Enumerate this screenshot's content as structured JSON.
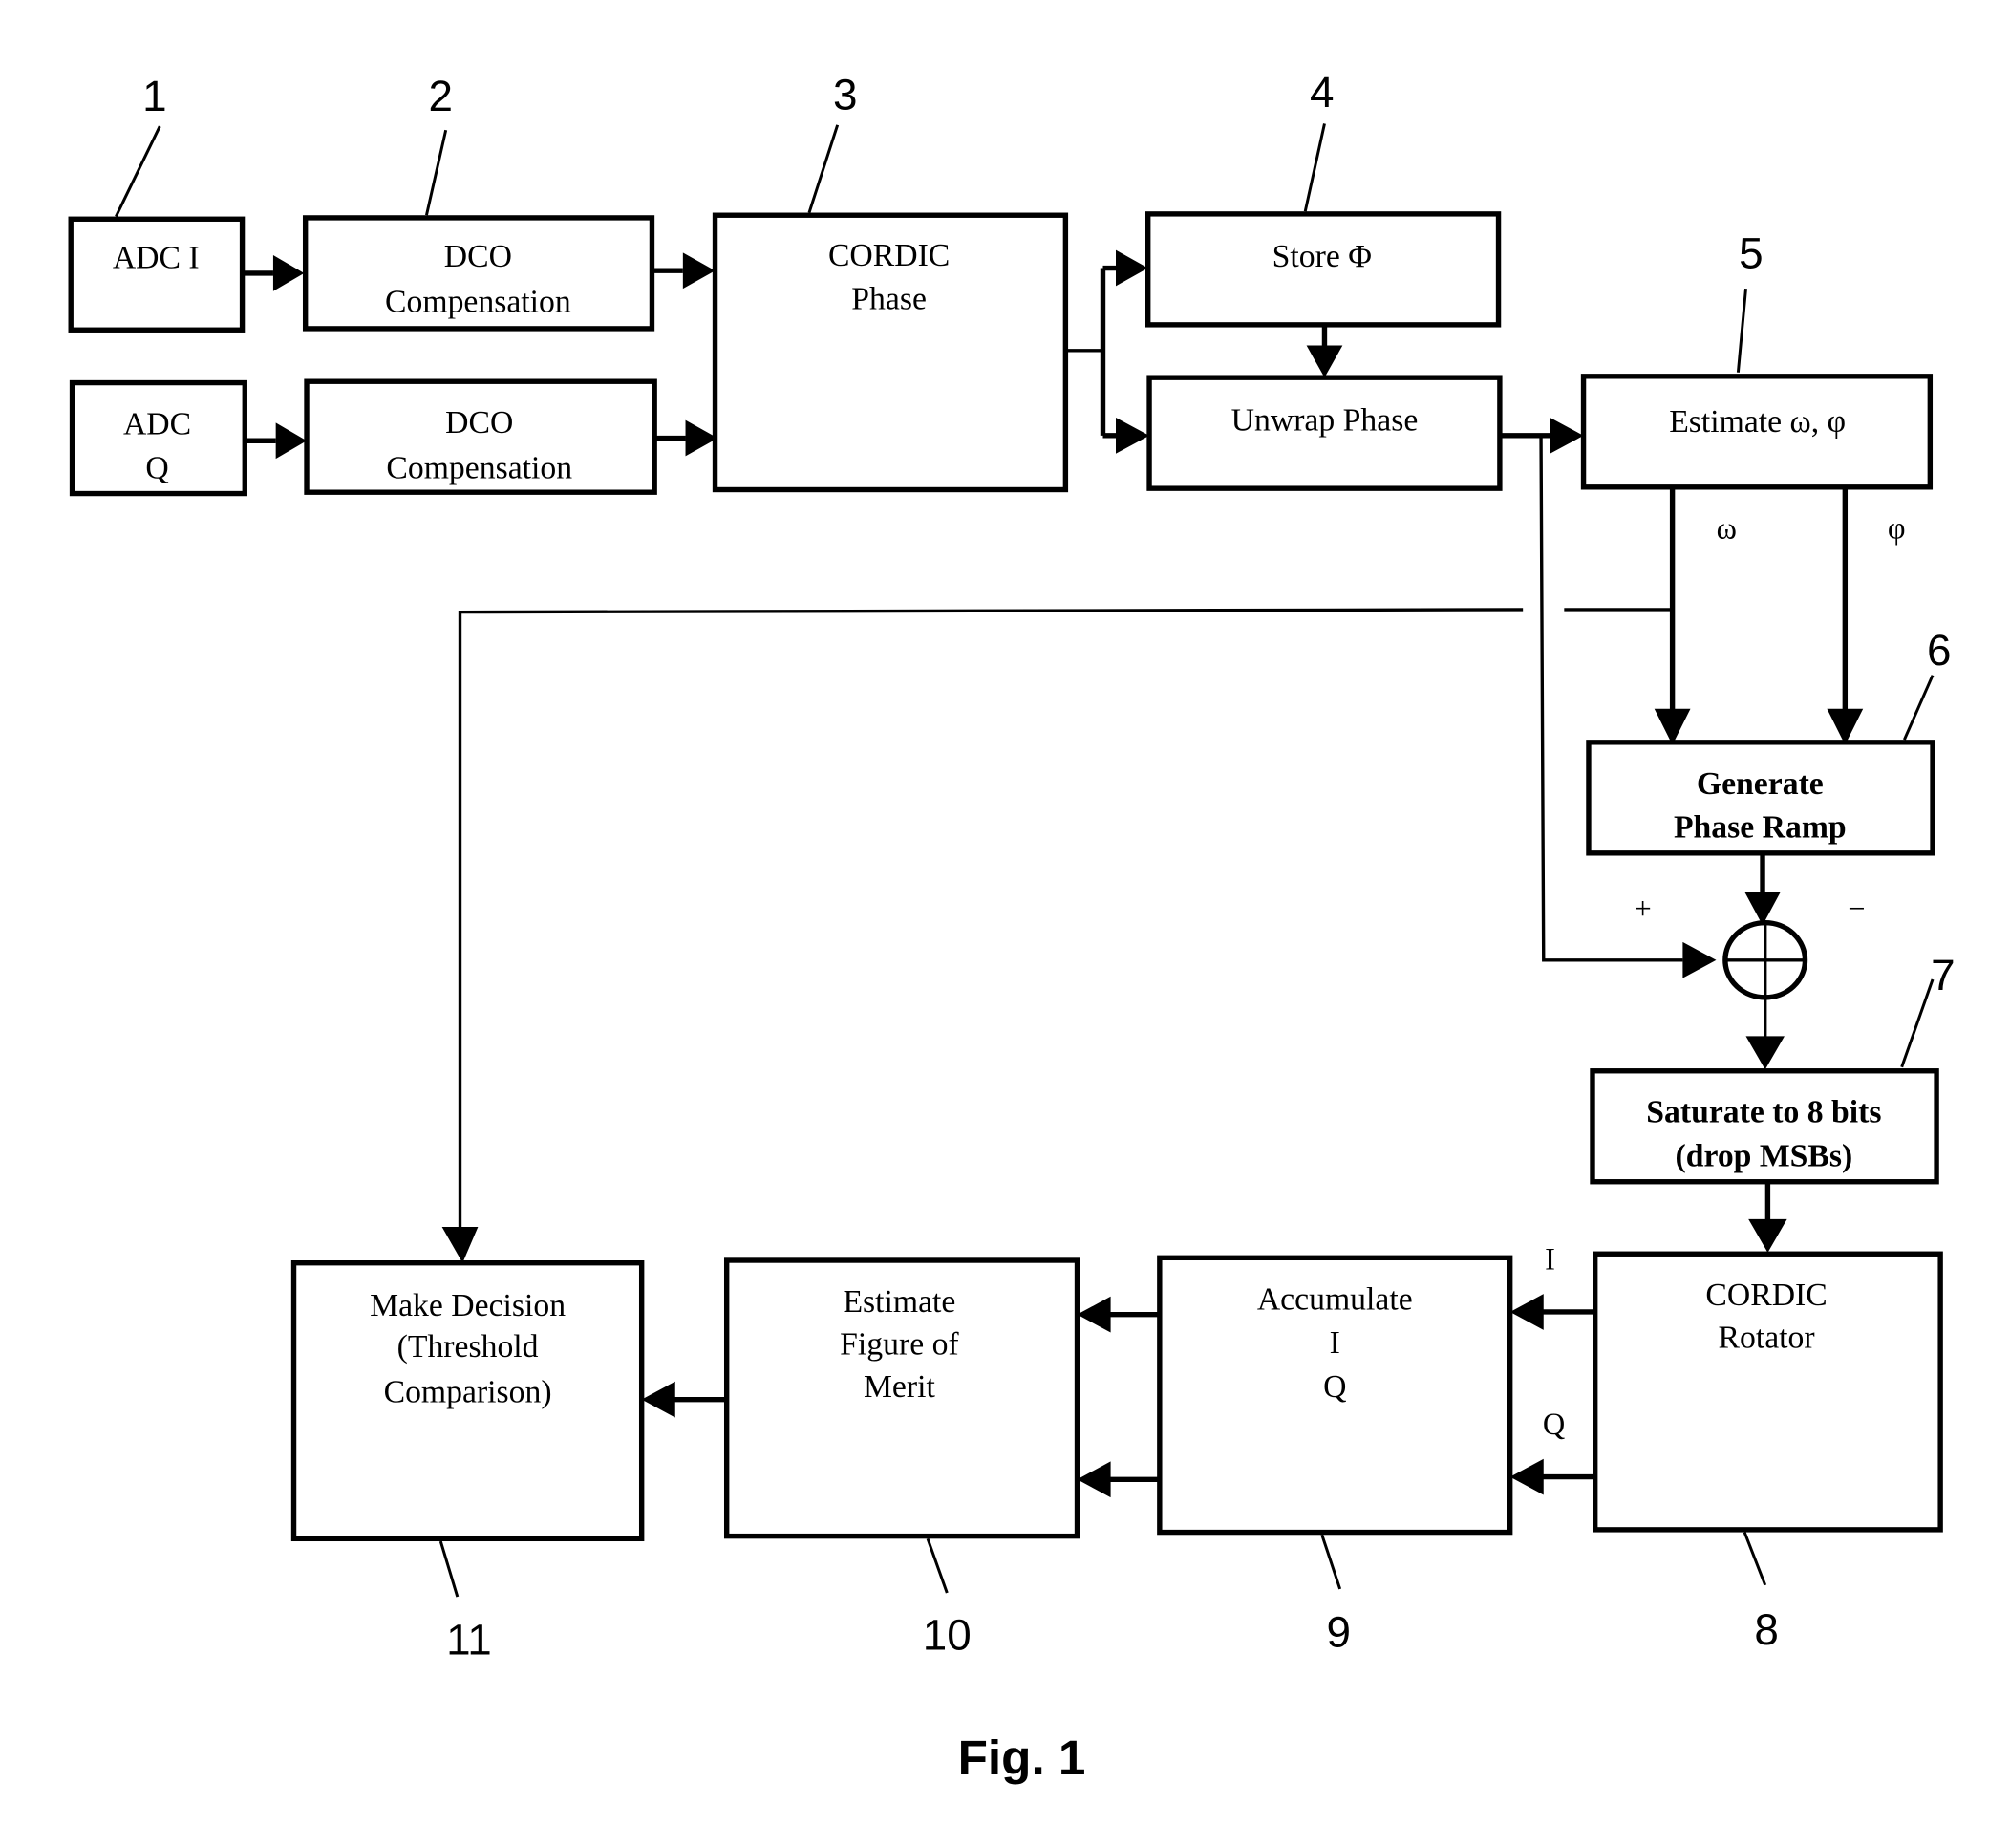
{
  "figure": {
    "caption": "Fig. 1",
    "blocks": [
      {
        "ref": "1",
        "lines": [
          "ADC I"
        ]
      },
      {
        "ref": "",
        "lines": [
          "ADC",
          "Q"
        ]
      },
      {
        "ref": "2",
        "lines": [
          "DCO",
          "Compensation"
        ]
      },
      {
        "ref": "",
        "lines": [
          "DCO",
          "Compensation"
        ]
      },
      {
        "ref": "3",
        "lines": [
          "CORDIC",
          "Phase"
        ]
      },
      {
        "ref": "4",
        "lines": [
          "Store Φ"
        ]
      },
      {
        "ref": "",
        "lines": [
          "Unwrap Phase"
        ]
      },
      {
        "ref": "5",
        "lines": [
          "Estimate ω, φ"
        ]
      },
      {
        "ref": "6",
        "lines": [
          "Generate",
          "Phase Ramp"
        ]
      },
      {
        "ref": "7",
        "lines": [
          "Saturate to 8 bits",
          "(drop MSBs)"
        ]
      },
      {
        "ref": "8",
        "lines": [
          "CORDIC",
          "Rotator"
        ]
      },
      {
        "ref": "9",
        "lines": [
          "Accumulate",
          "I",
          "Q"
        ]
      },
      {
        "ref": "10",
        "lines": [
          "Estimate",
          "Figure of",
          "Merit"
        ]
      },
      {
        "ref": "11",
        "lines": [
          "Make Decision",
          "(Threshold",
          "Comparison)"
        ]
      }
    ],
    "signals": {
      "omega": "ω",
      "phi": "φ",
      "plus": "+",
      "minus": "−",
      "i": "I",
      "q": "Q"
    }
  }
}
